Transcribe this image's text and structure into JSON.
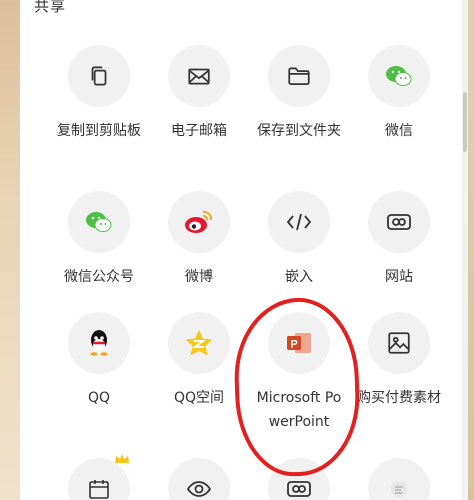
{
  "section": {
    "title": "共享"
  },
  "items": [
    {
      "label": "复制到剪贴板",
      "icon": "copy-icon"
    },
    {
      "label": "电子邮箱",
      "icon": "mail-icon"
    },
    {
      "label": "保存到文件夹",
      "icon": "folder-icon"
    },
    {
      "label": "微信",
      "icon": "wechat-icon"
    },
    {
      "label": "微信公众号",
      "icon": "wechat-official-icon"
    },
    {
      "label": "微博",
      "icon": "weibo-icon"
    },
    {
      "label": "嵌入",
      "icon": "embed-icon"
    },
    {
      "label": "网站",
      "icon": "link-icon"
    },
    {
      "label": "QQ",
      "icon": "qq-icon"
    },
    {
      "label": "QQ空间",
      "icon": "qzone-icon"
    },
    {
      "label": "Microsoft PowerPoint",
      "icon": "powerpoint-icon"
    },
    {
      "label": "购买付费素材",
      "icon": "image-icon"
    },
    {
      "label": "",
      "icon": "calendar-icon"
    },
    {
      "label": "",
      "icon": "eye-icon"
    },
    {
      "label": "",
      "icon": "link-icon"
    },
    {
      "label": "",
      "icon": "thumbnail-icon"
    }
  ],
  "colors": {
    "highlight": "#e41f1f",
    "wechat": "#4cbf45",
    "weibo": "#e6162d",
    "ppt": "#d24726",
    "qzone": "#f7c81c"
  }
}
